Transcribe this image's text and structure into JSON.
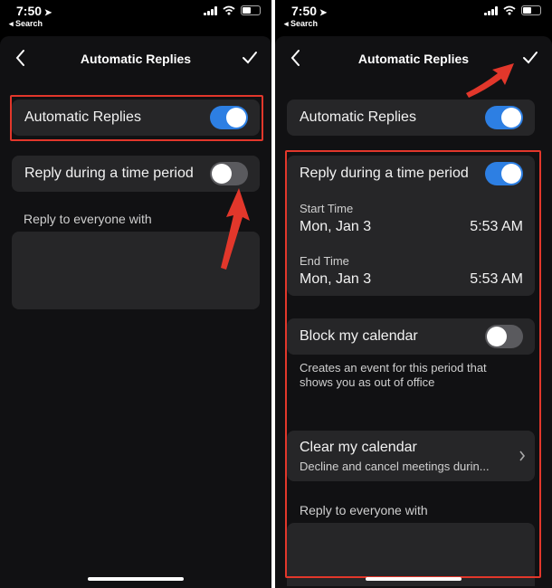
{
  "status_bar": {
    "time": "7:50",
    "back_label": "◂ Search"
  },
  "nav": {
    "title": "Automatic Replies"
  },
  "left": {
    "automatic_replies": {
      "label": "Automatic Replies",
      "on": true
    },
    "time_period": {
      "label": "Reply during a time period",
      "on": false
    },
    "reply_everyone_label": "Reply to everyone with",
    "reply_text": ""
  },
  "right": {
    "automatic_replies": {
      "label": "Automatic Replies",
      "on": true
    },
    "time_period": {
      "label": "Reply during a time period",
      "on": true
    },
    "start": {
      "label": "Start Time",
      "date": "Mon, Jan 3",
      "time": "5:53 AM"
    },
    "end": {
      "label": "End Time",
      "date": "Mon, Jan 3",
      "time": "5:53 AM"
    },
    "block_calendar": {
      "label": "Block my calendar",
      "on": false,
      "caption": "Creates an event for this period that shows you as out of office"
    },
    "clear_calendar": {
      "title": "Clear my calendar",
      "subtitle": "Decline and cancel meetings durin..."
    },
    "reply_everyone_label": "Reply to everyone with",
    "reply_text": ""
  },
  "icons": [
    "chevron-left-icon",
    "checkmark-icon",
    "chevron-right-icon",
    "location-arrow-icon",
    "signal-icon",
    "wifi-icon",
    "battery-icon",
    "red-arrow-icon"
  ],
  "colors": {
    "toggle_on": "#2d7fe3",
    "highlight": "#e2372b",
    "background": "#000000",
    "row": "#262628"
  }
}
